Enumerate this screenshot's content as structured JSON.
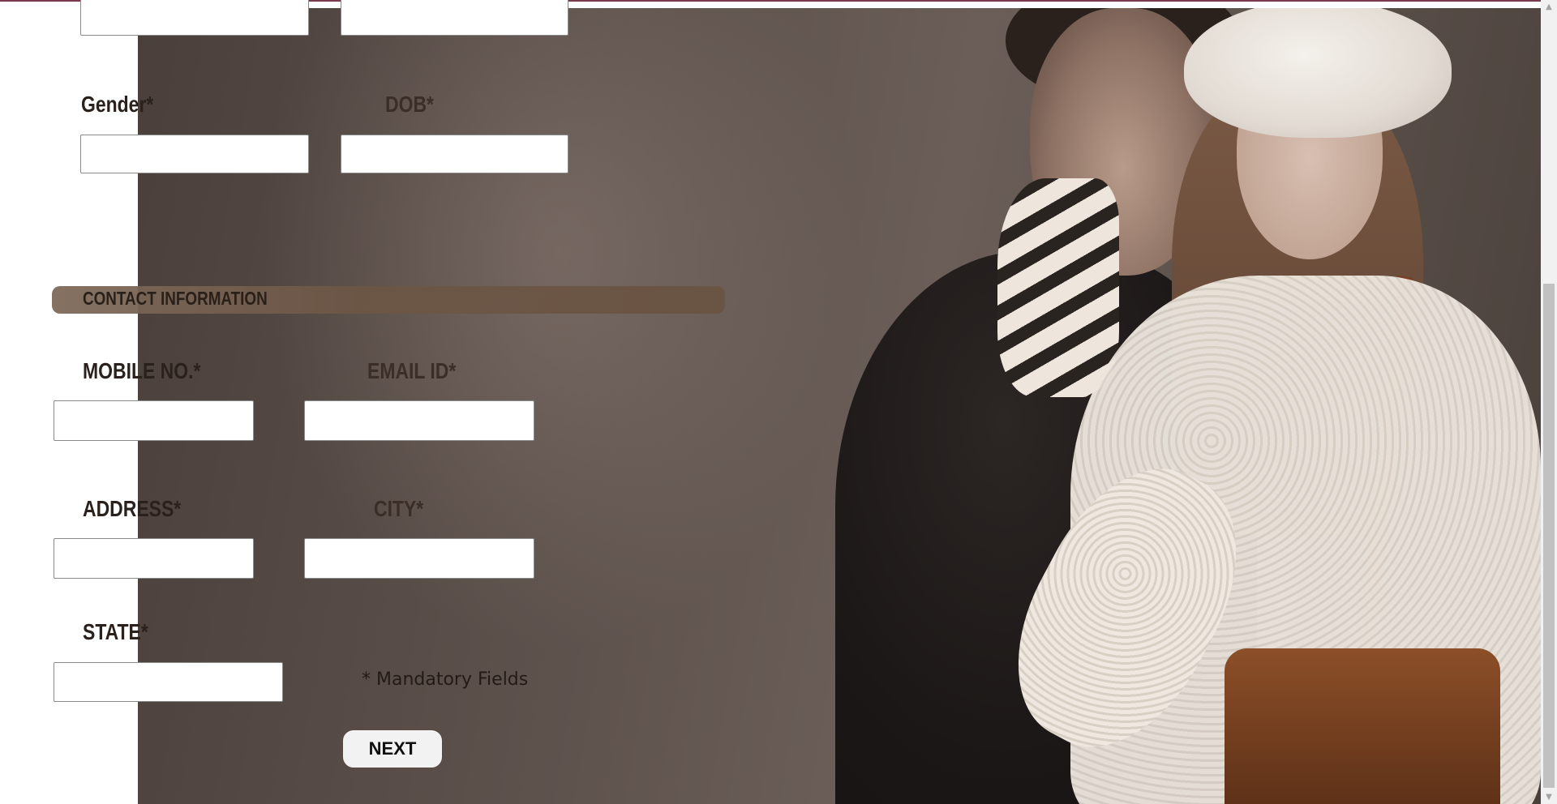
{
  "form": {
    "gender_label": "Gender*",
    "dob_label": "DOB*",
    "contact_section_title": "CONTACT INFORMATION",
    "mobile_label": "MOBILE NO.*",
    "email_label": "EMAIL ID*",
    "address_label": "ADDRESS*",
    "city_label": "CITY*",
    "state_label": "STATE*",
    "mandatory_note": "* Mandatory Fields",
    "next_label": "NEXT",
    "values": {
      "top_left": "",
      "top_right": "",
      "gender": "",
      "dob": "",
      "mobile": "",
      "email": "",
      "address": "",
      "city": "",
      "state": ""
    }
  },
  "scrollbar": {
    "up_icon": "▲",
    "down_icon": "▼"
  },
  "colors": {
    "top_border": "#7a3b52",
    "label": "#2b211c",
    "section_bar": "#6c5646"
  }
}
